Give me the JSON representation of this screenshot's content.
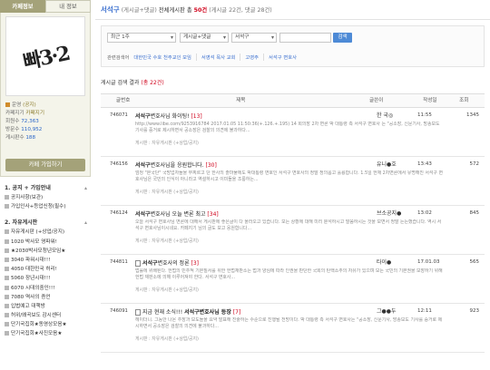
{
  "sidebar": {
    "tabs": [
      {
        "label": "카페정보"
      },
      {
        "label": "내 정보"
      }
    ],
    "logo_text": "빠3·2",
    "stats": {
      "manager_label": "운영",
      "manager_value": "(공지)",
      "level_label": "카페지기",
      "level_value": "카페지기",
      "members_label": "회원수",
      "members_value": "72,363",
      "visits_label": "방문수",
      "visits_value": "110,952",
      "posts_label": "게시판수",
      "posts_value": "188"
    },
    "join_button": "카페 가입하기",
    "menu_sections": [
      {
        "title": "1. 공지 + 가입안내",
        "items": [
          "공지사항(보관)",
          "가입인사+등업신청(필수)"
        ]
      },
      {
        "title": "2. 자유게시판",
        "items": [
          "자유게시판 (+상업/공지)",
          "1020 박사모 영파워!",
          "★2030박사모청년모임★",
          "3040 파워시대!!!",
          "4050 대한민국 허리!",
          "5060 장년시대!!!",
          "6070 시대의중인!!!",
          "7080 역사의 증언",
          "입법예고 대책방",
          "허위/왜곡보도 감시센터",
          "단기국집회★동영상모음★",
          "단기국집회★사진모음★"
        ]
      }
    ]
  },
  "main": {
    "title": "서석구",
    "subtitle": "(게시글+댓글)",
    "total_label": "전체게시판 총",
    "total_count": "50건",
    "breakdown": "(게시글 22건, 댓글 28건)",
    "filters": {
      "period": "최근 1주",
      "scope": "게시글+댓글",
      "keyword": "서석구",
      "search_button": "검색"
    },
    "quick_label": "관련검색어",
    "quick_links": [
      "대한민국 수호 천주교인 모임",
      "서영석 목사 교회",
      "고영주",
      "서석구 변호사"
    ],
    "result_header_prefix": "게시글 검색 결과",
    "result_count": "(총 22건)",
    "table": {
      "headers": [
        "글번호",
        "제목",
        "글쓴이",
        "작성일",
        "조회"
      ],
      "rows": [
        {
          "no": "746071",
          "title_bold": "서석구",
          "title_rest": "변호사님 화이팅!",
          "comments": "[13]",
          "author": "한 국◎",
          "date": "11:55",
          "views": "1345",
          "snippet": "http://www.libe.com/9253916784 2017.01.05 11:50:36(+.126.+.195) 14 회의장 2차 변론 박 대통령 측 서석구 변호사 는 \"공소장, 신문기사, 방송보도 기사를 증거로 제시하면서 공소장은 검찰의 의견에 불과하다...",
          "board": "게시판 : 자유게시판 (+상업/공지)"
        },
        {
          "no": "746156",
          "title_bold": "서석구",
          "title_rest": "변호사님을 응원합니다.",
          "comments": "[30]",
          "author": "유니●호",
          "date": "13:43",
          "views": "572",
          "snippet": "엄청 \"본국단\" 국방업자들을 무찌르고 단 한사의 출마물에도 박대통령 변호인 서석구 변호사의 정말 정의롭고 훌륭합니다. 1.5일 헌재 2차변론에서 유명해진 서석구 변호사님은 국민의 인식이 아니라고 역설하시고 이미들을 조롱하는...",
          "board": "게시판 : 자유게시판 (+상업/공지)"
        },
        {
          "no": "746124",
          "title_bold": "서석구",
          "title_rest": "변호사님 오늘 변론 최고",
          "comments": "[34]",
          "author": "브소공지●",
          "date": "13:02",
          "views": "845",
          "snippet": "오늘 서석구 변호사님 변론에 대해서 게시판에 좋은글이 다 올라오고 있습니다. 모든 상황에 대해 미리 분석하시고 말씀하시는 것을 보면서 정말 든든했습니다. 역시 서석구 변호사님이시네요. 카페지기 님의 글도 보고 응원합니다...",
          "board": "게시판 : 자유게시판 (+상업/공지)"
        },
        {
          "no": "744811",
          "title_bold": "서석구",
          "title_rest": "변호사의 정론",
          "comments": "[3]",
          "author": "타이●",
          "date": "17.01.03",
          "views": "565",
          "snippet": "법률에 위배된다. 헌법의 민주적 기본질서를 위한 헌법재판소는 법과 양심에 따라 인권을 판단한 국회의 탄핵소추의 자유가 있으며 모든 국민의 기본권을 보장하기 위해 헌법 재판소에 의해 이루어져야 한다. 서석구 변호사...",
          "board": "게시판 : 자유게시판 (+상업/공지)"
        },
        {
          "no": "746091",
          "title_bold": "지금 현재 소식!!!",
          "title_rest": "서석구변호사님 등장",
          "comments": "[7]",
          "author": "그●●두",
          "date": "12:11",
          "views": "923",
          "snippet": "헤이더니. 그동안 나온 주장과 보도들을 요약 발표해 진술하는 수준으로 진행될 전망이다. 박 대통령 측 서석구 변호사는 \"공소장, 신문기사, 방송보도 기사를 증거로 제시하면서 공소장은 검찰의 의견에 불과하다...",
          "board": "게시판 : 자유게시판 (+상업/공지)"
        }
      ]
    }
  },
  "colors": {
    "accent_olive": "#a4a279",
    "link_blue": "#3a6fcf",
    "highlight_red": "#d0021b",
    "search_blue": "#4d8ad6"
  }
}
